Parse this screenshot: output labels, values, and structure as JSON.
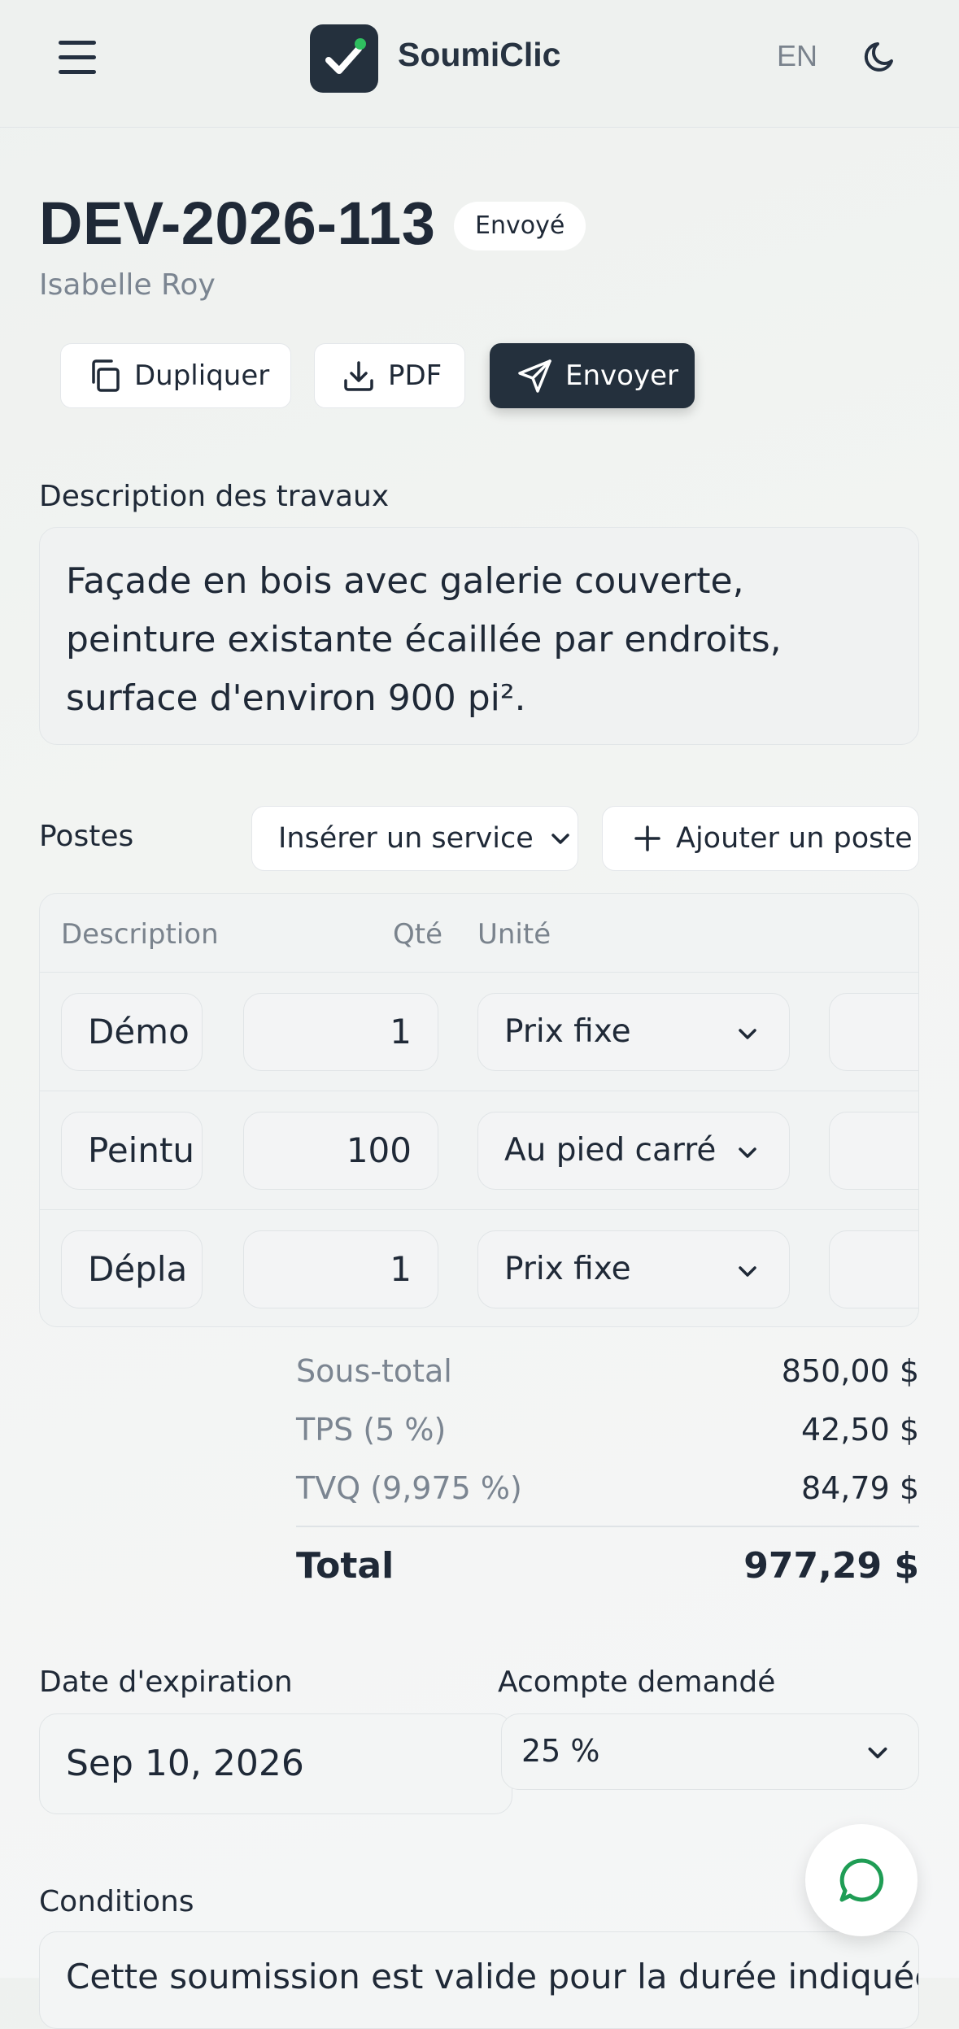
{
  "header": {
    "brand": "SoumiClic",
    "lang_toggle": "EN",
    "icons": [
      "menu-icon",
      "check-logo-icon",
      "moon-icon"
    ],
    "accent_color": "#2fbf5f",
    "dark_color": "#24303d"
  },
  "quote": {
    "number": "DEV-2026-113",
    "status": "Envoyé",
    "client": "Isabelle Roy"
  },
  "actions": {
    "duplicate": "Dupliquer",
    "pdf": "PDF",
    "send": "Envoyer"
  },
  "description": {
    "label": "Description des travaux",
    "value": "Façade en bois avec galerie couverte, peinture existante écaillée par endroits, surface d'environ 900 pi²."
  },
  "items_section": {
    "label": "Postes",
    "insert_service": "Insérer un service",
    "add_item": "Ajouter un poste",
    "columns": {
      "description": "Description",
      "qty": "Qté",
      "unit": "Unité"
    },
    "rows": [
      {
        "description": "Démo",
        "qty": "1",
        "unit": "Prix fixe"
      },
      {
        "description": "Peintu",
        "qty": "100",
        "unit": "Au pied carré"
      },
      {
        "description": "Dépla",
        "qty": "1",
        "unit": "Prix fixe"
      }
    ]
  },
  "totals": {
    "subtotal_label": "Sous-total",
    "subtotal": "850,00 $",
    "tps_label": "TPS (5 %)",
    "tps": "42,50 $",
    "tvq_label": "TVQ (9,975 %)",
    "tvq": "84,79 $",
    "total_label": "Total",
    "total": "977,29 $"
  },
  "expiration": {
    "label": "Date d'expiration",
    "value": "Sep 10, 2026"
  },
  "deposit": {
    "label": "Acompte demandé",
    "value": "25 %"
  },
  "conditions": {
    "label": "Conditions",
    "value": "Cette soumission est valide pour la durée indiquée"
  }
}
